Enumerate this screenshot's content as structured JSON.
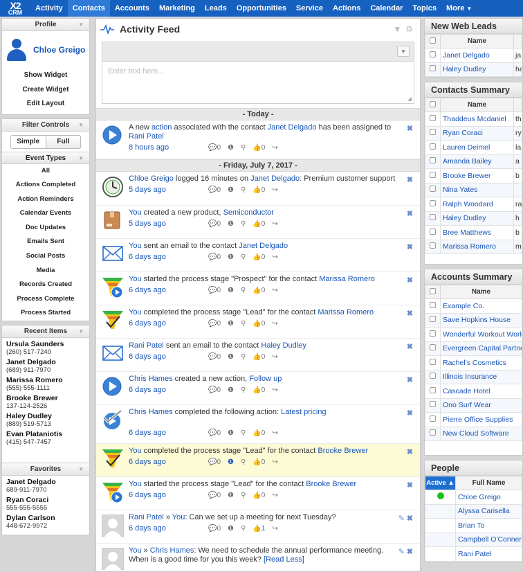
{
  "app": {
    "logo_top": "X2",
    "logo_bottom": "CRM",
    "nav": [
      "Activity",
      "Contacts",
      "Accounts",
      "Marketing",
      "Leads",
      "Opportunities",
      "Service",
      "Actions",
      "Calendar",
      "Topics",
      "More"
    ]
  },
  "left": {
    "profile_header": "Profile",
    "user_name": "Chloe Greigo",
    "menu": [
      "Show Widget",
      "Create Widget",
      "Edit Layout"
    ],
    "filter_header": "Filter Controls",
    "toggle": [
      "Simple",
      "Full"
    ],
    "event_types_header": "Event Types",
    "event_types": [
      "All",
      "Actions Completed",
      "Action Reminders",
      "Calendar Events",
      "Doc Updates",
      "Emails Sent",
      "Social Posts",
      "Media",
      "Records Created",
      "Process Complete",
      "Process Started"
    ],
    "recent_header": "Recent Items",
    "recent": [
      {
        "name": "Ursula Saunders",
        "phone": "(260) 517-7240"
      },
      {
        "name": "Janet Delgado",
        "phone": "(689) 911-7970"
      },
      {
        "name": "Marissa Romero",
        "phone": "(555) 555-1111"
      },
      {
        "name": "Brooke Brewer",
        "phone": "137-124-2526"
      },
      {
        "name": "Haley Dudley",
        "phone": "(889) 519-5713"
      },
      {
        "name": "Evan Plataniotis",
        "phone": "(415) 547-7457"
      }
    ],
    "favorites_header": "Favorites",
    "favorites": [
      {
        "name": "Janet Delgado",
        "phone": "689-911-7970"
      },
      {
        "name": "Ryan Coraci",
        "phone": "555-555-5555"
      },
      {
        "name": "Dylan Carlson",
        "phone": "448-672-9972"
      }
    ]
  },
  "feed": {
    "title": "Activity Feed",
    "placeholder": "Enter text here...",
    "sep_today": "- Today -",
    "sep_date": "- Friday, July 7, 2017 -",
    "events": [
      {
        "icon": "play",
        "a": "A new ",
        "l1": "action",
        "b": " associated with the contact ",
        "l2": "Janet Delgado",
        "c": " has been assigned to ",
        "l3": "Rani Patel",
        "d": "",
        "time": "8 hours ago",
        "comments": "0",
        "likes": "0"
      },
      {
        "icon": "clock",
        "a": "",
        "l1": "Chloe Greigo",
        "b": " logged 16 minutes on ",
        "l2": "Janet Delgado",
        "c": ": Premium customer support",
        "l3": "",
        "d": "",
        "time": "5 days ago",
        "comments": "0",
        "likes": "0"
      },
      {
        "icon": "box",
        "a": "",
        "l1": "You",
        "b": " created a new product, ",
        "l2": "Semiconductor",
        "c": "",
        "l3": "",
        "d": "",
        "time": "5 days ago",
        "comments": "0",
        "likes": "0"
      },
      {
        "icon": "mail",
        "a": "",
        "l1": "You",
        "b": " sent an email to the contact ",
        "l2": "Janet Delgado",
        "c": "",
        "l3": "",
        "d": "",
        "time": "6 days ago",
        "comments": "0",
        "likes": "0"
      },
      {
        "icon": "funnel-play",
        "a": "",
        "l1": "You",
        "b": " started the process stage \"Prospect\" for the contact ",
        "l2": "Marissa Romero",
        "c": "",
        "l3": "",
        "d": "",
        "time": "6 days ago",
        "comments": "0",
        "likes": "0"
      },
      {
        "icon": "funnel-check",
        "a": "",
        "l1": "You",
        "b": " completed the process stage \"Lead\" for the contact ",
        "l2": "Marissa Romero",
        "c": "",
        "l3": "",
        "d": "",
        "time": "6 days ago",
        "comments": "0",
        "likes": "0"
      },
      {
        "icon": "mail",
        "a": "",
        "l1": "Rani Patel",
        "b": " sent an email to the contact ",
        "l2": "Haley Dudley",
        "c": "",
        "l3": "",
        "d": "",
        "time": "6 days ago",
        "comments": "0",
        "likes": "0"
      },
      {
        "icon": "play",
        "a": "",
        "l1": "Chris Hames",
        "b": " created a new action, ",
        "l2": "Follow up",
        "c": "",
        "l3": "",
        "d": "",
        "time": "6 days ago",
        "comments": "0",
        "likes": "0"
      },
      {
        "icon": "play-check",
        "a": "",
        "l1": "Chris Hames",
        "b": " completed the following action: ",
        "l2": "Latest pricing",
        "c": "",
        "l3": "",
        "d": "",
        "time": "6 days ago",
        "comments": "0",
        "likes": "0"
      },
      {
        "icon": "funnel-check",
        "a": "",
        "l1": "You",
        "b": " completed the process stage \"Lead\" for the contact ",
        "l2": "Brooke Brewer",
        "c": "",
        "l3": "",
        "d": "",
        "time": "6 days ago",
        "comments": "0",
        "likes": "0"
      },
      {
        "icon": "funnel-play",
        "a": "",
        "l1": "You",
        "b": " started the process stage \"Lead\" for the contact ",
        "l2": "Brooke Brewer",
        "c": "",
        "l3": "",
        "d": "",
        "time": "6 days ago",
        "comments": "0",
        "likes": "0"
      },
      {
        "icon": "avatar",
        "a": "",
        "l1": "Rani Patel",
        "b": " » ",
        "l2": "You",
        "c": ": Can we set up a meeting for next Tuesday?",
        "l3": "",
        "d": "",
        "time": "6 days ago",
        "comments": "0",
        "likes": "1"
      },
      {
        "icon": "avatar",
        "a": "",
        "l1": "You",
        "b": " » ",
        "l2": "Chris Hames",
        "c": ": We need to schedule the annual performance meeting. When is a good time for you this week? ",
        "l3": "[Read Less]",
        "d": "",
        "time": "",
        "comments": "",
        "likes": ""
      }
    ]
  },
  "right": {
    "web_leads_title": "New Web Leads",
    "name_col": "Name",
    "web_leads": [
      {
        "name": "Janet Delgado",
        "ext": "ja"
      },
      {
        "name": "Haley Dudley",
        "ext": "ha"
      }
    ],
    "contacts_title": "Contacts Summary",
    "contacts": [
      {
        "name": "Thaddeus Mcdaniel",
        "ext": "th"
      },
      {
        "name": "Ryan Coraci",
        "ext": "ry"
      },
      {
        "name": "Lauren Deimel",
        "ext": "la"
      },
      {
        "name": "Amanda Bailey",
        "ext": "a"
      },
      {
        "name": "Brooke Brewer",
        "ext": "b"
      },
      {
        "name": "Nina Yates",
        "ext": ""
      },
      {
        "name": "Ralph Woodard",
        "ext": "ra"
      },
      {
        "name": "Haley Dudley",
        "ext": "h"
      },
      {
        "name": "Bree Matthews",
        "ext": "b"
      },
      {
        "name": "Marissa Romero",
        "ext": "m"
      }
    ],
    "accounts_title": "Accounts Summary",
    "accounts": [
      "Example Co.",
      "Save Hopkins House",
      "Wonderful Workout Work",
      "Evergreen Capital Partne",
      "Rachel's Cosmetics",
      "Illinois Insurance",
      "Cascade Hotel",
      "Ono Surf Wear",
      "Pierre Office Supplies",
      "New Cloud Software"
    ],
    "people_title": "People",
    "people_active_col": "Active",
    "people_name_col": "Full Name",
    "people": [
      "Chloe Greigo",
      "Alyssa Carisella",
      "Brian To",
      "Campbell O'Conner",
      "Rani Patel"
    ]
  }
}
